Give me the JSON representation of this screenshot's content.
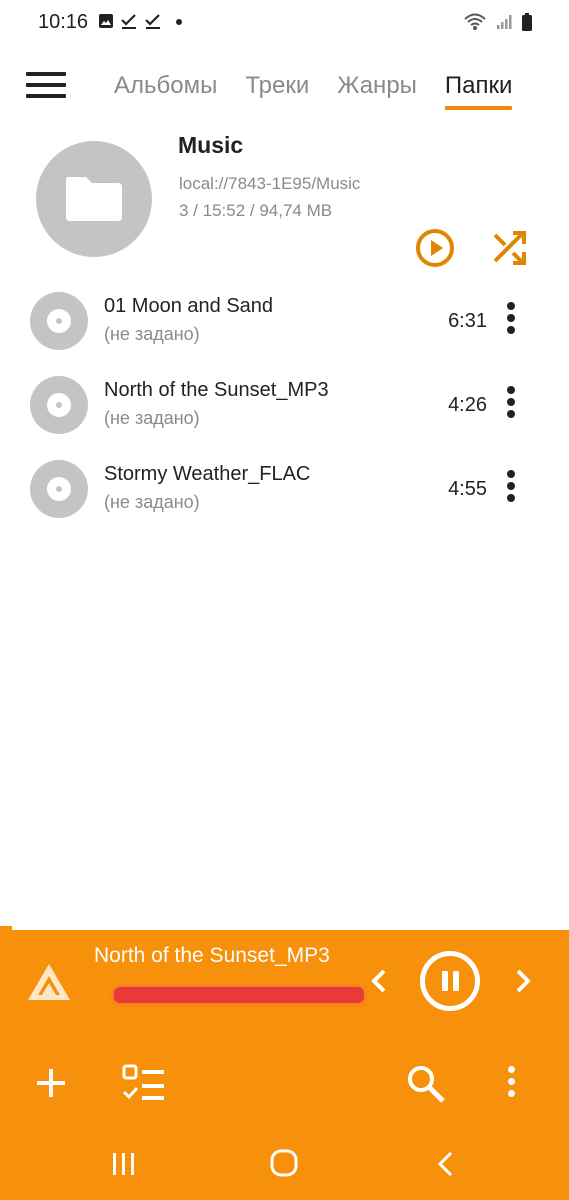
{
  "status_bar": {
    "time": "10:16",
    "icons_left": [
      "image-icon",
      "check-icon",
      "check-icon",
      "dot-icon"
    ],
    "icons_right": [
      "wifi-icon",
      "signal-icon",
      "battery-icon"
    ]
  },
  "tabs": [
    {
      "label": "Альбомы",
      "active": false
    },
    {
      "label": "Треки",
      "active": false
    },
    {
      "label": "Жанры",
      "active": false
    },
    {
      "label": "Папки",
      "active": true
    }
  ],
  "folder": {
    "title": "Music",
    "path": "local://7843-1E95/Music",
    "stats": "3 / 15:52 / 94,74 MB",
    "icon": "folder-icon"
  },
  "tracks": [
    {
      "title": "01 Moon and Sand",
      "artist": "(не задано)",
      "duration": "6:31"
    },
    {
      "title": "North of the Sunset_MP3",
      "artist": "(не задано)",
      "duration": "4:26"
    },
    {
      "title": "Stormy Weather_FLAC",
      "artist": "(не задано)",
      "duration": "4:55"
    }
  ],
  "player": {
    "now_playing_title": "North of the Sunset_MP3",
    "state": "playing",
    "accent_color": "#f7900a"
  },
  "colors": {
    "accent": "#f08c00",
    "player_bg": "#f7900a",
    "muted_text": "#8a8a8a",
    "placeholder_gray": "#c4c4c4"
  }
}
